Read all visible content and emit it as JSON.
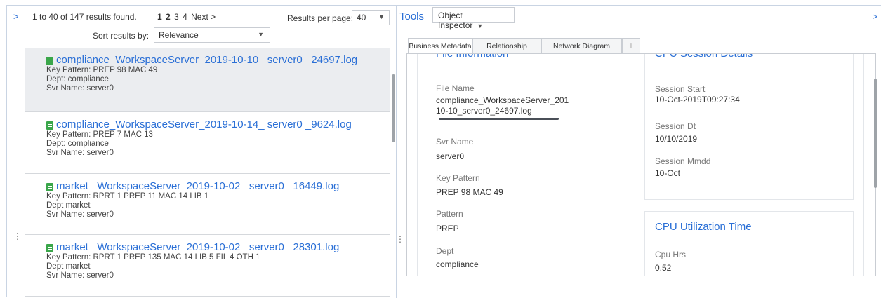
{
  "results": {
    "count_text": "1 to 40 of 147 results found.",
    "pages": [
      "1",
      "2",
      "3",
      "4"
    ],
    "next_label": "Next >",
    "per_page_label": "Results per page:",
    "per_page_value": "40",
    "sort_label": "Sort results by:",
    "sort_value": "Relevance",
    "items": [
      {
        "title": "compliance_WorkspaceServer_2019-10-10_ server0 _24697.log",
        "line1": "Key Pattern:  PREP 98 MAC 49",
        "line2": "Dept:  compliance",
        "line3": "Svr Name:   server0"
      },
      {
        "title": "compliance_WorkspaceServer_2019-10-14_ server0 _9624.log",
        "line1": "Key Pattern:  PREP 7 MAC 13",
        "line2": "Dept:  compliance",
        "line3": "Svr Name:   server0"
      },
      {
        "title": "market _WorkspaceServer_2019-10-02_ server0 _16449.log",
        "line1": "Key Pattern:  RPRT 1 PREP 11 MAC 14 LIB 1",
        "line2": "Dept   market",
        "line3": "Svr Name:   server0"
      },
      {
        "title": "market _WorkspaceServer_2019-10-02_ server0 _28301.log",
        "line1": "Key Pattern:  RPRT 1 PREP 135 MAC 14 LIB 5 FIL 4 OTH 1",
        "line2": "Dept   market",
        "line3": "Svr Name:   server0"
      }
    ]
  },
  "tools": {
    "label": "Tools",
    "inspector_value": "Object Inspector",
    "tabs": [
      "Business Metadata",
      "Relationship",
      "Network Diagram"
    ],
    "add_tab": "+",
    "file_info": {
      "title": "File Information",
      "file_name_label": "File Name",
      "file_name_line1": "compliance_WorkspaceServer_201",
      "file_name_line2": "10-10_server0_24697.log",
      "svr_name_label": "Svr Name",
      "svr_name_value": "server0",
      "key_pattern_label": "Key Pattern",
      "key_pattern_value": "PREP 98 MAC 49",
      "pattern_label": "Pattern",
      "pattern_value": "PREP",
      "dept_label": "Dept",
      "dept_value": "compliance"
    },
    "session": {
      "title": "CPU Session Details",
      "start_label": "Session Start",
      "start_value": "10-Oct-2019T09:27:34",
      "dt_label": "Session Dt",
      "dt_value": "10/10/2019",
      "mmdd_label": "Session Mmdd",
      "mmdd_value": "10-Oct"
    },
    "cpu": {
      "title": "CPU Utilization Time",
      "hrs_label": "Cpu Hrs",
      "hrs_value": "0.52"
    }
  },
  "icons": {
    "expand_left": ">",
    "expand_right": ">",
    "caret": "▼",
    "drag_handle": "⋮",
    "file": "spreadsheet-file-icon"
  },
  "colors": {
    "accent": "#2a6fd6",
    "file_icon": "#3aa64a",
    "selected_row": "#ebedf0"
  }
}
